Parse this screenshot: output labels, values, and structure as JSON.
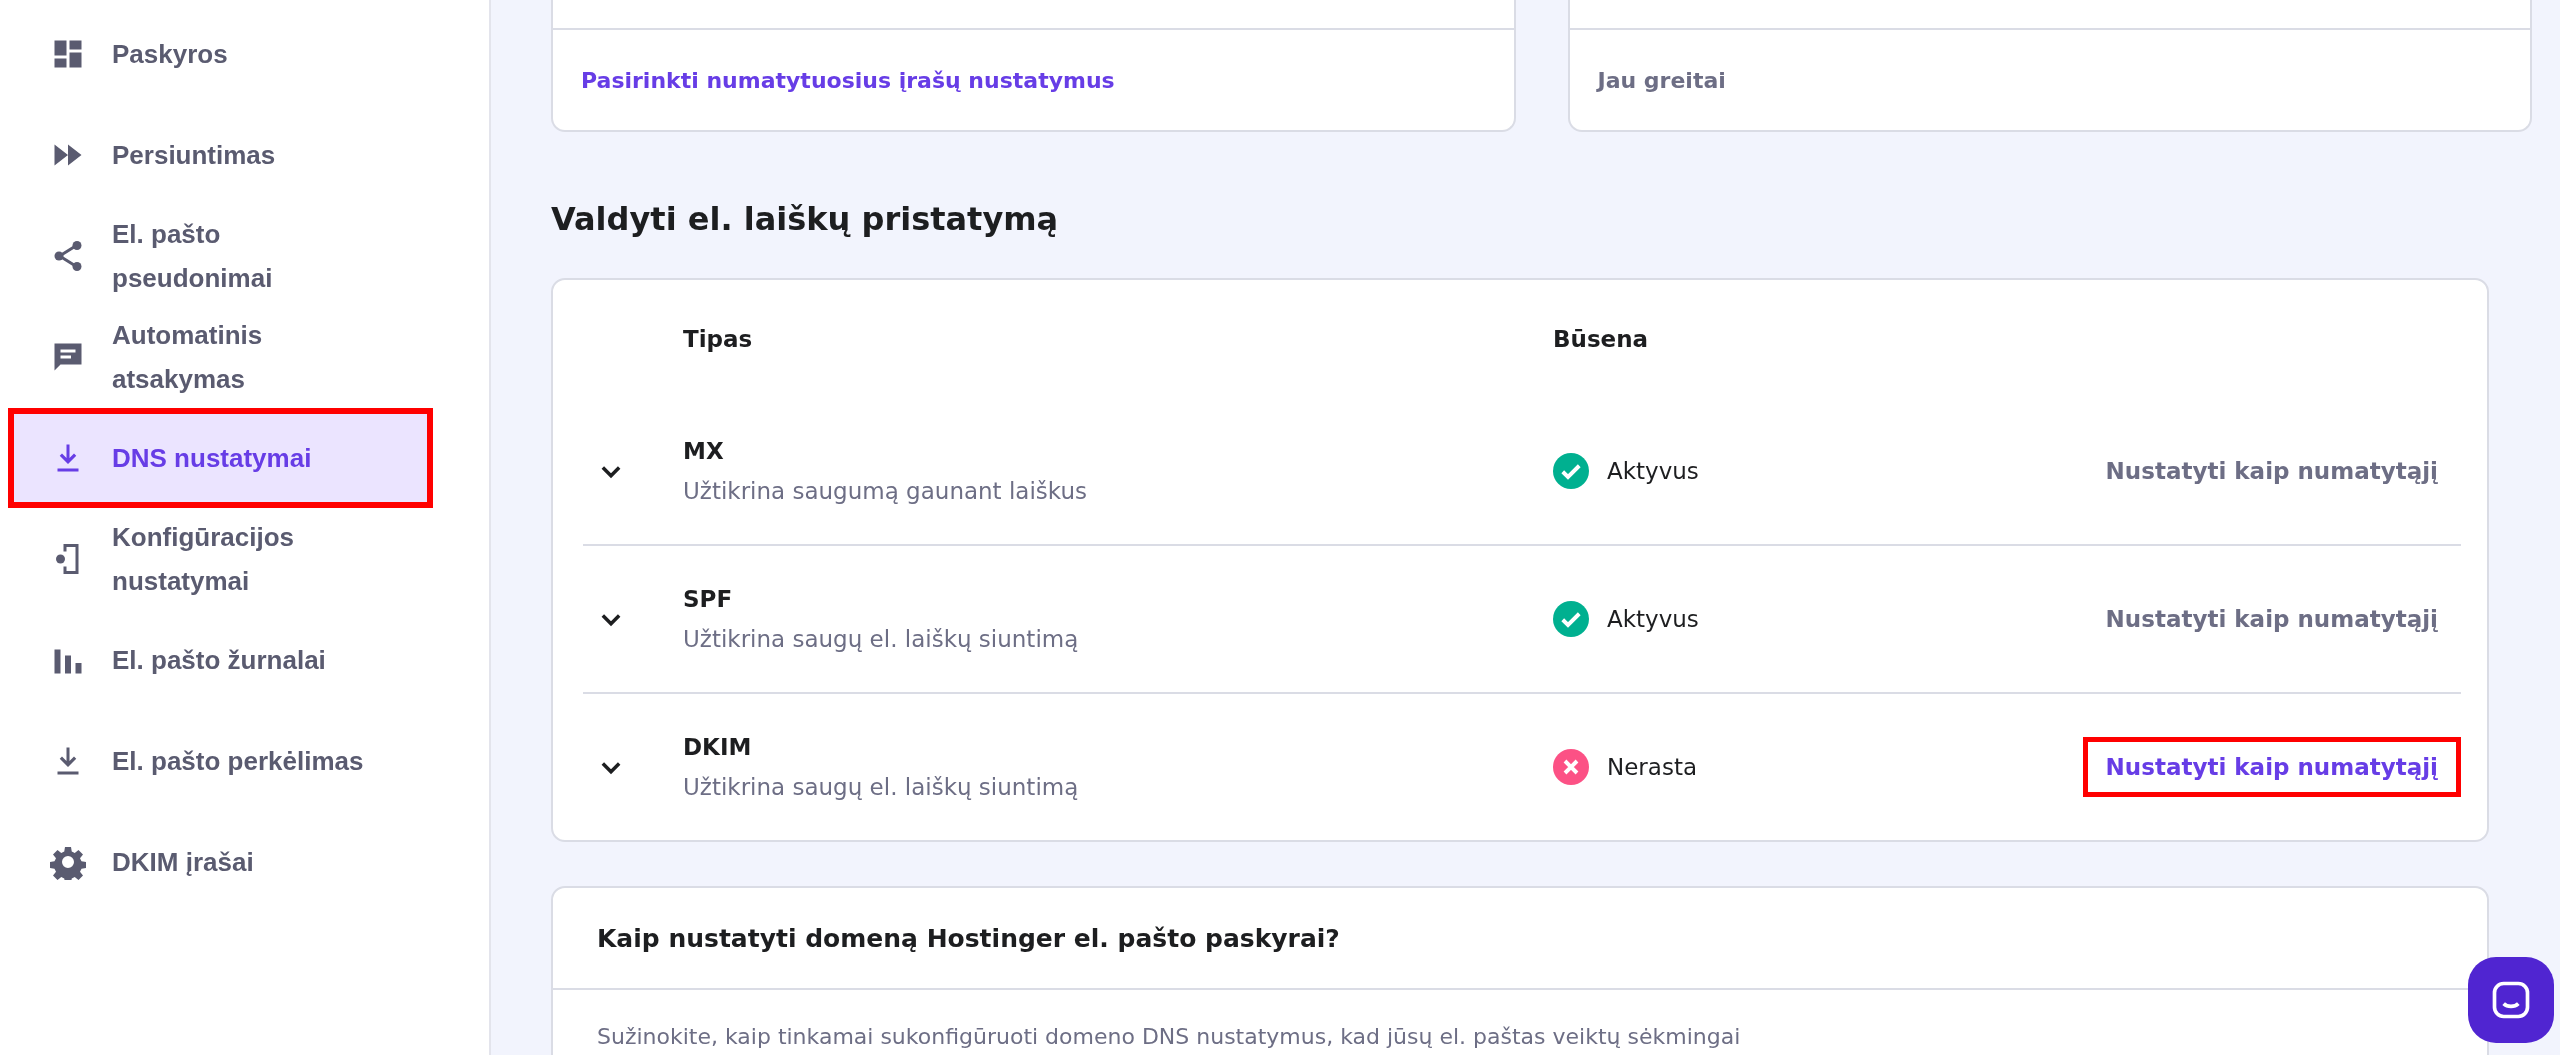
{
  "sidebar": {
    "items": [
      {
        "label": "Paskyros",
        "selected": false,
        "highlighted": false
      },
      {
        "label": "Persiuntimas",
        "selected": false,
        "highlighted": false
      },
      {
        "label": "El. pašto pseudonimai",
        "selected": false,
        "highlighted": false
      },
      {
        "label": "Automatinis atsakymas",
        "selected": false,
        "highlighted": false
      },
      {
        "label": "DNS nustatymai",
        "selected": true,
        "highlighted": true
      },
      {
        "label": "Konfigūracijos nustatymai",
        "selected": false,
        "highlighted": false
      },
      {
        "label": "El. pašto žurnalai",
        "selected": false,
        "highlighted": false
      },
      {
        "label": "El. pašto perkėlimas",
        "selected": false,
        "highlighted": false
      },
      {
        "label": "DKIM įrašai",
        "selected": false,
        "highlighted": false
      }
    ]
  },
  "top_cards": [
    {
      "footer": "Pasirinkti numatytuosius įrašų nustatymus",
      "disabled": false
    },
    {
      "footer": "Jau greitai",
      "disabled": true
    }
  ],
  "delivery": {
    "heading": "Valdyti el. laiškų pristatymą",
    "columns": [
      "Tipas",
      "Būsena"
    ],
    "rows": [
      {
        "type": "MX",
        "description": "Užtikrina saugumą gaunant laiškus",
        "status": "Aktyvus",
        "active": true,
        "action": "Nustatyti kaip numatytąjį",
        "action_enabled": false,
        "highlighted": false
      },
      {
        "type": "SPF",
        "description": "Užtikrina saugų el. laiškų siuntimą",
        "status": "Aktyvus",
        "active": true,
        "action": "Nustatyti kaip numatytąjį",
        "action_enabled": false,
        "highlighted": false
      },
      {
        "type": "DKIM",
        "description": "Užtikrina saugų el. laiškų siuntimą",
        "status": "Nerasta",
        "active": false,
        "action": "Nustatyti kaip numatytąjį",
        "action_enabled": true,
        "highlighted": true
      }
    ]
  },
  "help_card": {
    "title": "Kaip nustatyti domeną Hostinger el. pašto paskyrai?",
    "text": "Sužinokite, kaip tinkamai sukonfigūruoti domeno DNS nustatymus, kad jūsų el. paštas veiktų sėkmingai"
  }
}
